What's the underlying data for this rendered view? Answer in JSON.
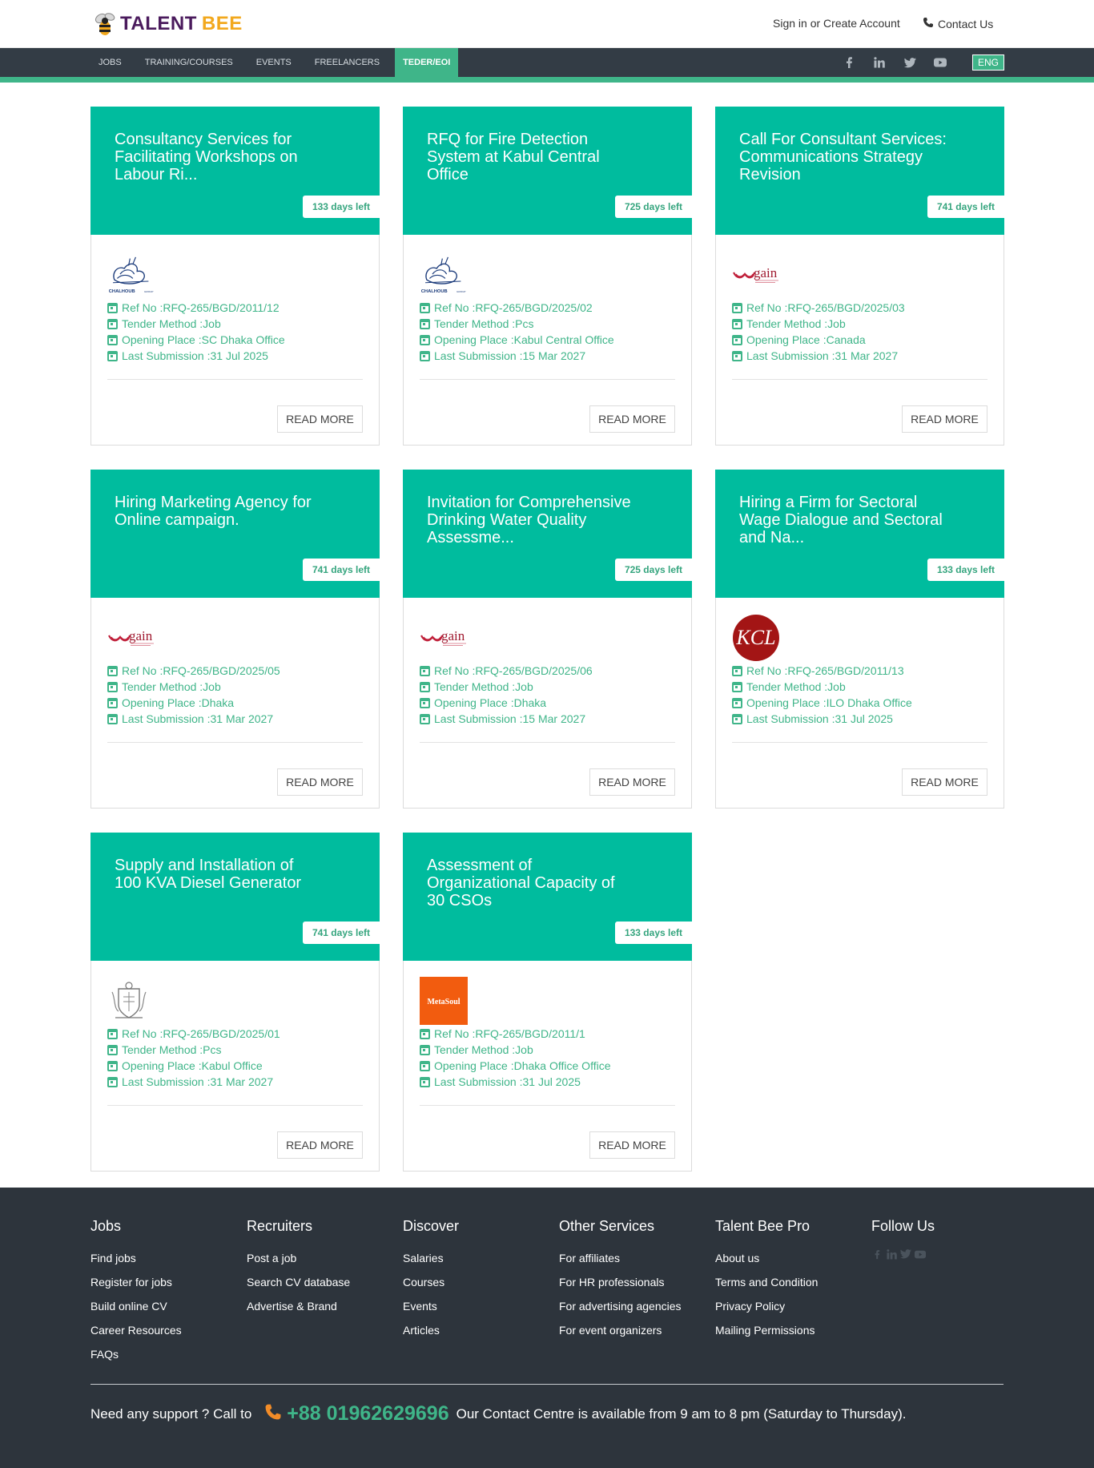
{
  "brand": {
    "name_part1": "TALENT",
    "name_part2": "BEE"
  },
  "header": {
    "sign_in": "Sign in",
    "or": "or",
    "create_account": "Create Account",
    "contact": "Contact Us"
  },
  "nav": {
    "items": [
      "JOBS",
      "TRAINING/COURSES",
      "EVENTS",
      "FREELANCERS",
      "TEDER/EOI"
    ],
    "active_index": 4,
    "social_icons": [
      "facebook-icon",
      "linkedin-icon",
      "twitter-icon",
      "youtube-icon"
    ],
    "language": "ENG"
  },
  "labels": {
    "ref": "Ref No : ",
    "method": "Tender Method : ",
    "place": "Opening Place : ",
    "submission": "Last Submission : ",
    "read_more": "READ MORE"
  },
  "cards": [
    {
      "title": "Consultancy Services for Facilitating Workshops on Labour Ri...",
      "days": "133 days left",
      "logo": "chalhoub",
      "ref": "RFQ-265/BGD/2011/12",
      "method": "Job",
      "place": "SC Dhaka Office",
      "submission": "31 Jul 2025"
    },
    {
      "title": "RFQ for Fire Detection System at Kabul Central Office",
      "days": "725 days left",
      "logo": "chalhoub",
      "ref": "RFQ-265/BGD/2025/02",
      "method": "Pcs",
      "place": "Kabul Central Office",
      "submission": "15 Mar 2027"
    },
    {
      "title": "Call For Consultant Services: Communications Strategy Revision",
      "days": "741 days left",
      "logo": "gain",
      "ref": "RFQ-265/BGD/2025/03",
      "method": "Job",
      "place": "Canada",
      "submission": "31 Mar 2027"
    },
    {
      "title": "Hiring Marketing Agency for Online campaign.",
      "days": "741 days left",
      "logo": "gain",
      "ref": "RFQ-265/BGD/2025/05",
      "method": "Job",
      "place": "Dhaka",
      "submission": "31 Mar 2027"
    },
    {
      "title": "Invitation for Comprehensive Drinking Water Quality Assessme...",
      "days": "725 days left",
      "logo": "gain",
      "ref": "RFQ-265/BGD/2025/06",
      "method": "Job",
      "place": "Dhaka",
      "submission": "15 Mar 2027"
    },
    {
      "title": "Hiring a Firm for Sectoral Wage Dialogue and Sectoral and Na...",
      "days": "133 days left",
      "logo": "kcl",
      "ref": "RFQ-265/BGD/2011/13",
      "method": "Job",
      "place": "ILO Dhaka Office",
      "submission": "31 Jul 2025"
    },
    {
      "title": "Supply and Installation of 100 KVA Diesel Generator",
      "days": "741 days left",
      "logo": "crest",
      "ref": "RFQ-265/BGD/2025/01",
      "method": "Pcs",
      "place": "Kabul Office",
      "submission": "31 Mar 2027"
    },
    {
      "title": "Assessment of Organizational Capacity of 30 CSOs",
      "days": "133 days left",
      "logo": "metasoul",
      "ref": "RFQ-265/BGD/2011/1",
      "method": "Job",
      "place": "Dhaka Office Office",
      "submission": "31 Jul 2025"
    }
  ],
  "logo_text": {
    "chalhoub": "CHALHOUB",
    "gain": "gain",
    "kcl": "KCL",
    "metasoul": "MetaSoul"
  },
  "footer": {
    "columns": [
      {
        "title": "Jobs",
        "links": [
          "Find jobs",
          "Register for jobs",
          "Build online CV",
          "Career Resources",
          "FAQs"
        ]
      },
      {
        "title": "Recruiters",
        "links": [
          "Post a job",
          "Search CV database",
          "Advertise & Brand"
        ]
      },
      {
        "title": "Discover",
        "links": [
          "Salaries",
          "Courses",
          "Events",
          "Articles"
        ]
      },
      {
        "title": "Other Services",
        "links": [
          "For affiliates",
          "For HR professionals",
          "For advertising agencies",
          "For event organizers"
        ]
      },
      {
        "title": "Talent Bee Pro",
        "links": [
          "About us",
          "Terms and Condition",
          "Privacy Policy",
          "Mailing Permissions"
        ]
      },
      {
        "title": "Follow Us",
        "links": []
      }
    ],
    "support_prefix": "Need any support ? Call to",
    "phone": "+88 01962629696",
    "support_suffix": "Our Contact Centre is available from 9 am to 8 pm (Saturday to Thursday)."
  },
  "colors": {
    "accent": "#00bc9e",
    "green": "#3fb589",
    "dark": "#333c45",
    "footer": "#2d343c"
  }
}
